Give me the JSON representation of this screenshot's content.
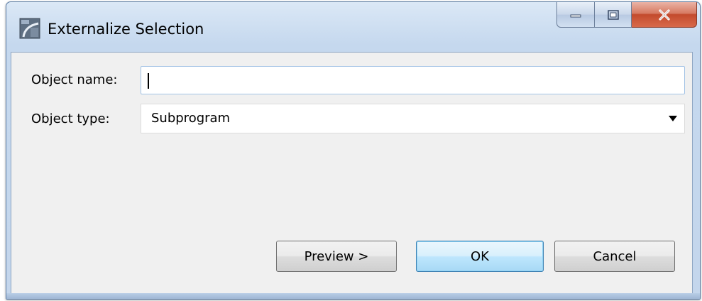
{
  "window": {
    "title": "Externalize Selection",
    "icon": "externalize-app-icon"
  },
  "caption": {
    "minimize_icon": "minimize-icon",
    "maximize_icon": "maximize-icon",
    "close_icon": "close-icon"
  },
  "form": {
    "name_label": "Object name:",
    "name_value": "",
    "type_label": "Object type:",
    "type_value": "Subprogram"
  },
  "buttons": {
    "preview": "Preview >",
    "ok": "OK",
    "cancel": "Cancel"
  },
  "colors": {
    "titlebar": "#c5d8ee",
    "client": "#f0f0f0",
    "close_button": "#c34b2d",
    "default_button_border": "#3c7fb1"
  }
}
